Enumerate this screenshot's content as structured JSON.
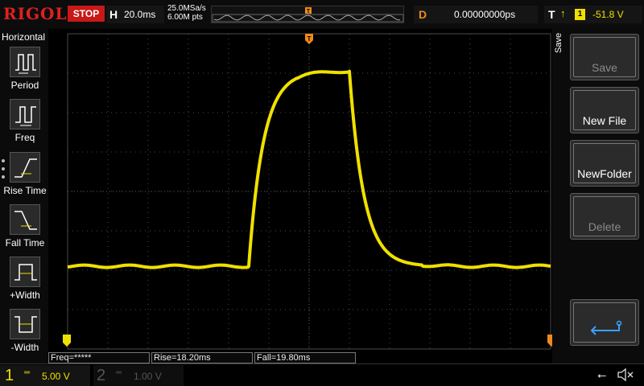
{
  "brand": "RIGOL",
  "top": {
    "run_state": "STOP",
    "horizontal_letter": "H",
    "timebase": "20.0ms",
    "sample_rate": "25.0MSa/s",
    "memory_depth": "6.00M pts",
    "delay_letter": "D",
    "delay_value": "0.00000000ps",
    "trigger_letter": "T",
    "trigger_edge": "rising-edge-icon",
    "trigger_source": "1",
    "trigger_level": "-51.8 V"
  },
  "left_menu": {
    "title": "Horizontal",
    "items": [
      {
        "label": "Period",
        "icon": "period-icon"
      },
      {
        "label": "Freq",
        "icon": "frequency-icon"
      },
      {
        "label": "Rise Time",
        "icon": "rise-time-icon"
      },
      {
        "label": "Fall Time",
        "icon": "fall-time-icon"
      },
      {
        "label": "+Width",
        "icon": "positive-width-icon"
      },
      {
        "label": "-Width",
        "icon": "negative-width-icon"
      }
    ]
  },
  "right_menu": {
    "title": "Save",
    "buttons": [
      {
        "label": "Save",
        "enabled": false
      },
      {
        "label": "New File",
        "enabled": true
      },
      {
        "label": "NewFolder",
        "enabled": true
      },
      {
        "label": "Delete",
        "enabled": false
      },
      {
        "label": "",
        "icon": "return-arrow-icon",
        "enabled": true
      }
    ]
  },
  "measurements": {
    "freq": "Freq=*****",
    "rise": "Rise=18.20ms",
    "fall": "Fall=19.80ms"
  },
  "channels": [
    {
      "number": "1",
      "scale": "5.00 V",
      "active": true,
      "color": "#f0e000"
    },
    {
      "number": "2",
      "scale": "1.00 V",
      "active": false,
      "color": "#555555"
    }
  ],
  "waveform": {
    "color": "#f0e000",
    "low_level_div": -1.9,
    "high_level_div": 3.05,
    "rise_start_div": -1.5,
    "fall_start_div": 1.0
  },
  "status_icons": [
    "usb-icon",
    "speaker-mute-icon"
  ]
}
